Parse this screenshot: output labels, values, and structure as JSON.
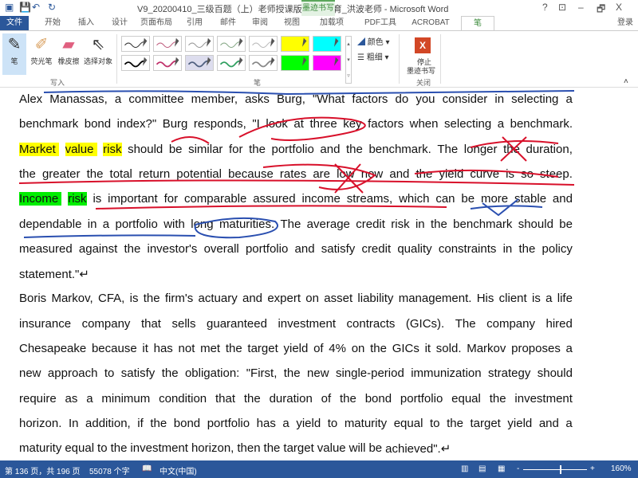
{
  "title": "V9_20200410_三级百题（上）老师授课版_金程教育_洪波老师 - Microsoft Word",
  "context_tab": "墨迹书写工具",
  "window_controls": [
    "?",
    "⊡",
    "–",
    "🗗",
    "X"
  ],
  "login": "登录",
  "tabs": [
    "文件",
    "开始",
    "插入",
    "设计",
    "页面布局",
    "引用",
    "邮件",
    "审阅",
    "视图",
    "加载项",
    "PDF工具",
    "ACROBAT",
    "笔"
  ],
  "ribbon": {
    "tools": [
      "笔",
      "荧光笔",
      "橡皮擦",
      "选择对象"
    ],
    "group_write": "写入",
    "group_pens": "笔",
    "color": "颜色",
    "thickness": "粗细",
    "stop": "停止\n墨迹书写",
    "stop_line1": "停止",
    "stop_line2": "墨迹书写",
    "group_close": "关闭",
    "pen_colors": [
      "#333333",
      "#c06080",
      "#999999",
      "#88aa88",
      "#bbbbbb",
      "#ffff00",
      "#00ffff",
      "#000000",
      "#c0306a",
      "#506080",
      "#30a060",
      "#888888",
      "#00ff00",
      "#ff00ff"
    ]
  },
  "document": {
    "lines": [
      [
        {
          "t": "Alex Manassas, a committee member, asks Burg, \"What factors do you consider in selecting a"
        }
      ],
      [
        {
          "t": "benchmark bond index?\" Burg responds, \"I look at three key factors when selecting a benchmark."
        }
      ],
      [
        {
          "t": "Market value risk",
          "hl": "y"
        },
        {
          "t": " should be similar for the portfolio and the benchmark. The longer the duration,"
        }
      ],
      [
        {
          "t": "the greater the total return potential because rates are low now and the yield curve is so steep."
        }
      ],
      [
        {
          "t": "Income risk",
          "hl": "g"
        },
        {
          "t": " is important for comparable assured income streams, which can be more stable and"
        }
      ],
      [
        {
          "t": "dependable in a portfolio with long maturities. The average credit risk in the benchmark should be"
        }
      ],
      [
        {
          "t": "measured against the investor's overall portfolio and satisfy credit quality constraints in the policy"
        }
      ],
      [
        {
          "t": "statement.\"↵",
          "last": true
        }
      ],
      [
        {
          "t": "Boris Markov, CFA, is the firm's actuary and expert on asset liability management. His client is a life"
        }
      ],
      [
        {
          "t": "insurance company that sells guaranteed investment contracts (GICs). The company hired"
        }
      ],
      [
        {
          "t": "Chesapeake because it has not met the target yield of 4% on the GICs it sold. Markov proposes a"
        }
      ],
      [
        {
          "t": "new approach to satisfy the obligation: \"First, the new single-period immunization strategy should"
        }
      ],
      [
        {
          "t": "require as a minimum condition that the duration of the bond portfolio equal the investment"
        }
      ],
      [
        {
          "t": "horizon. In addition, if the bond portfolio has a yield to maturity equal to the target yield and a"
        }
      ],
      [
        {
          "t": "maturity equal to the investment horizon, then the target value will be achieved\".↵",
          "last": true
        }
      ]
    ]
  },
  "status": {
    "page": "第 136 页，共 196 页",
    "words": "55078 个字",
    "lang": "中文(中国)",
    "zoom": "160%"
  },
  "ink_colors": {
    "red": "#d8102a",
    "blue": "#2a4fb0"
  }
}
